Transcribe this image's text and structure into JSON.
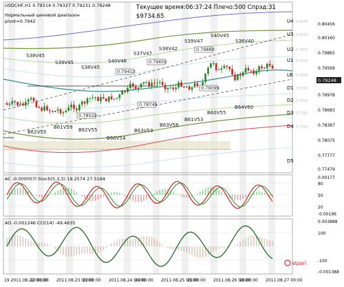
{
  "header": {
    "symbol_line": "USDCHF,H1  0.79314 0.79327 0.79231 0.79248",
    "range_label": "Нормальный ценовой диапазон",
    "pivot_label": "pivot=0.7942",
    "status_line": "Текущее время:06:37:24 Плечо:500 Спрэд:31",
    "balance": "$9734.65"
  },
  "levels": [
    {
      "name": "U4",
      "price": "0.8049"
    },
    {
      "name": "U3",
      "price": "0.8010"
    },
    {
      "name": "U2",
      "price": "0.7972"
    },
    {
      "name": "U1",
      "price": "0.7934"
    },
    {
      "name": "LB",
      "price": "0.7896"
    },
    {
      "name": "D1",
      "price": "0.7858"
    },
    {
      "name": "D2",
      "price": "0.7820"
    },
    {
      "name": "D3",
      "price": "0.7781"
    },
    {
      "name": "D4",
      "price": "0.7743"
    },
    {
      "name": "D5",
      "price": ""
    }
  ],
  "price_axis": [
    "0.80456",
    "0.80160",
    "0.79865",
    "0.79569",
    "0.79248",
    "0.78978",
    "0.78683",
    "0.78387",
    "0.78075",
    "0.77777",
    "0.77479"
  ],
  "current_price": "0.79248",
  "chart_data": {
    "type": "line",
    "title": "USDCHF,H1",
    "xlabel": "",
    "ylabel": "",
    "x": [
      "19 2011.08.22 00:00",
      "22 00:00",
      "2011.08.23 00:00",
      "23 00:00",
      "2011.08.24 00:00",
      "24 00:00",
      "2011.08.25 00:00",
      "25 00:00",
      "2011.08.26 00:00",
      "26 00:00",
      "2011.08.27 00:00"
    ],
    "price_labels": [
      {
        "text": "0.79413"
      },
      {
        "text": "0.79602"
      },
      {
        "text": "0.79880"
      },
      {
        "text": "0.79099"
      },
      {
        "text": "0.78745"
      },
      {
        "text": "0.78523"
      }
    ],
    "volume_labels": [
      {
        "text": "S38V45"
      },
      {
        "text": "S39V45"
      },
      {
        "text": "S38V45"
      },
      {
        "text": "S40V46"
      },
      {
        "text": "S37V47"
      },
      {
        "text": "S38V42"
      },
      {
        "text": "S39V47"
      },
      {
        "text": "S40V45"
      },
      {
        "text": "S36V40"
      },
      {
        "text": "B62V55"
      },
      {
        "text": "B61V59"
      },
      {
        "text": "B62V55"
      },
      {
        "text": "B60V54"
      },
      {
        "text": "B63V53"
      },
      {
        "text": "B63V58"
      },
      {
        "text": "B61V53"
      },
      {
        "text": "B60V55"
      },
      {
        "text": "B64V60"
      }
    ],
    "series": []
  },
  "stoch_panel": {
    "label": "AC -0.000057l  Stoch(5,3,3) 19.2574 27.5184",
    "axis": [
      "0.00177",
      "80",
      "50",
      "20",
      "-0.00196"
    ]
  },
  "cci_panel": {
    "label": "AO -0.001246  CCI(14) -49.4635",
    "axis": [
      "0.003888",
      "100",
      "-100",
      "-0.001388"
    ]
  },
  "logo": "alpari"
}
